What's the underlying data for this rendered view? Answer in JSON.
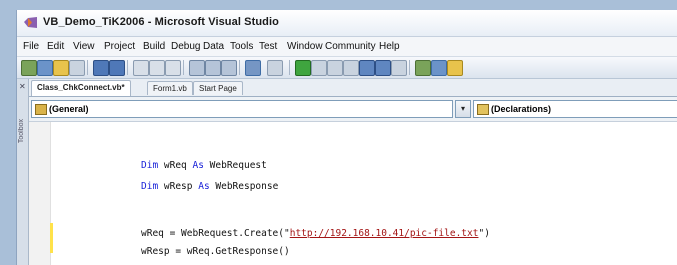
{
  "window": {
    "title": "VB_Demo_TiK2006 - Microsoft Visual Studio"
  },
  "menu": {
    "items": [
      "File",
      "Edit",
      "View",
      "Project",
      "Build",
      "Debug",
      "Data",
      "Tools",
      "Test",
      "Window",
      "Community",
      "Help"
    ]
  },
  "sidebar": {
    "label": "Toolbox"
  },
  "tabs": [
    {
      "label": "Class_ChkConnect.vb*",
      "active": true
    },
    {
      "label": "Form1.vb",
      "active": false
    },
    {
      "label": "Start Page",
      "active": false
    }
  ],
  "combos": {
    "class_name": "(General)",
    "method_name": "(Declarations)",
    "dropdown_glyph": "▾"
  },
  "code": {
    "line1": {
      "kw1": "Dim",
      "id1": " wReq ",
      "kw2": "As",
      "id2": " WebRequest"
    },
    "line2": {
      "kw1": "Dim",
      "id1": " wResp ",
      "kw2": "As",
      "id2": " WebResponse"
    },
    "line3": {
      "pre": "wReq = WebRequest.Create(\"",
      "url": "http://192.168.10.41/pic-file.txt",
      "post": "\")"
    },
    "line4": {
      "text": "wResp = wReq.GetResponse()"
    }
  },
  "colors": {
    "keyword": "#1a22d8",
    "string": "#a31515",
    "change_bar": "#ffe24a"
  }
}
